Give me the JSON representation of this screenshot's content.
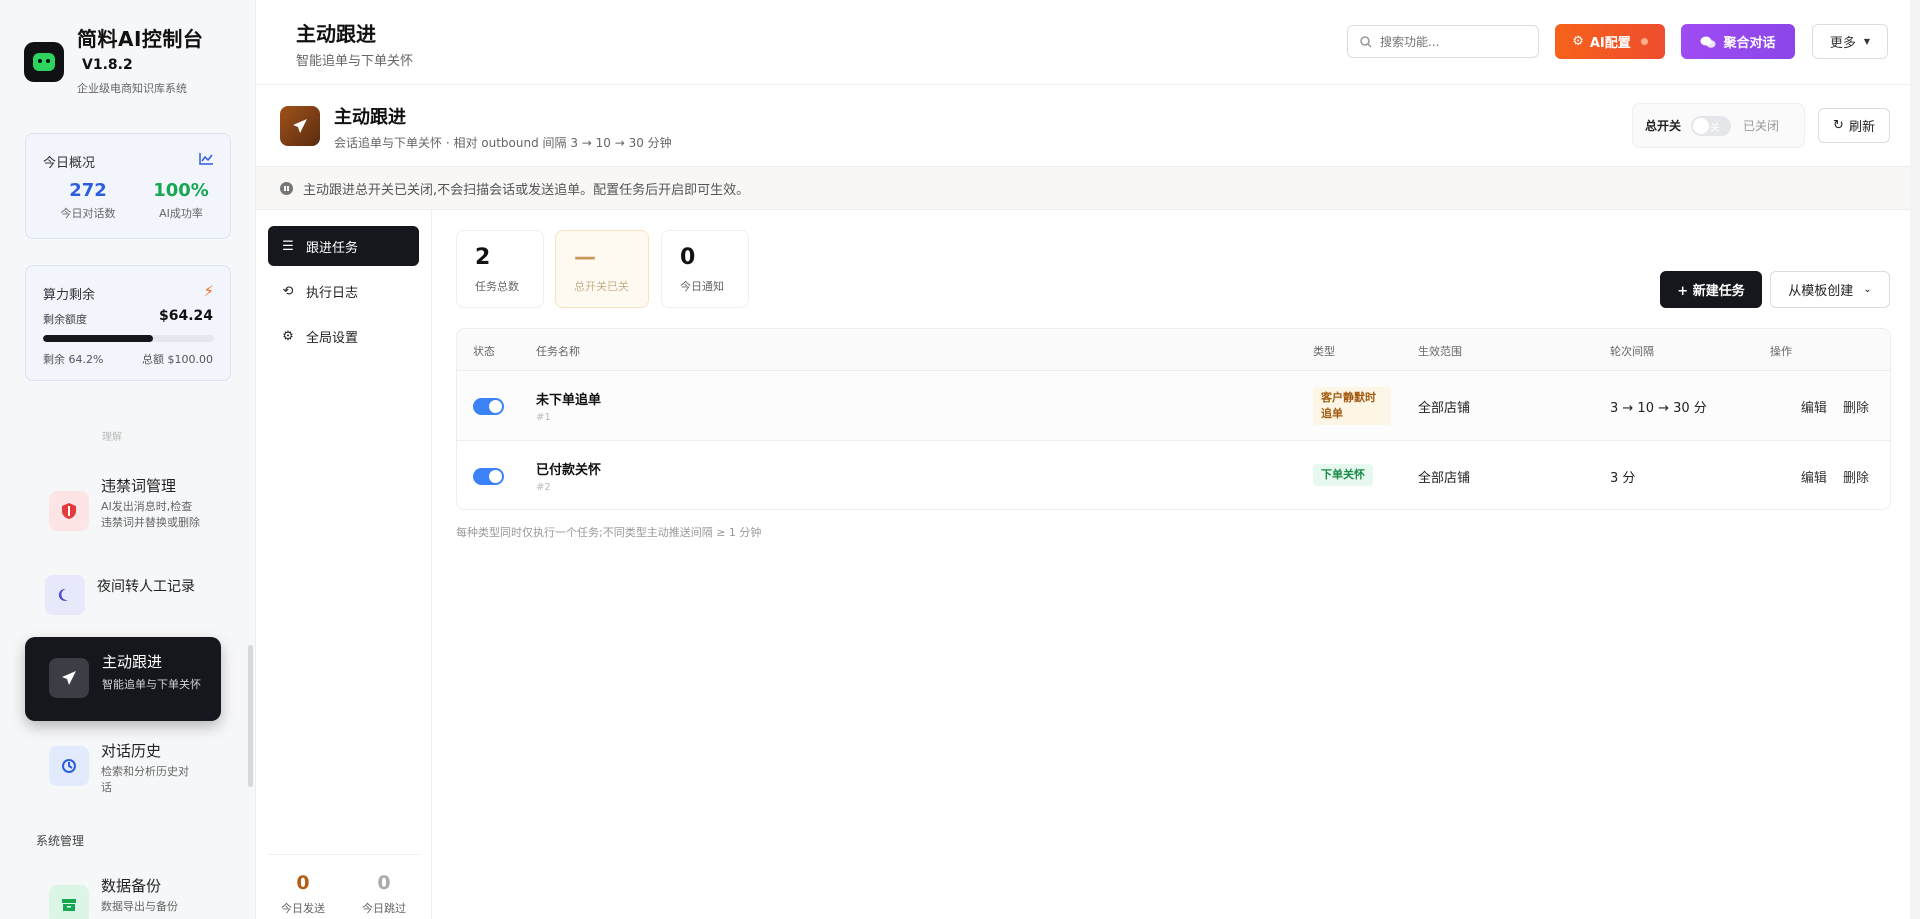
{
  "brand": {
    "name": "简料AI控制台",
    "version": "V1.8.2",
    "subtitle": "企业级电商知识库系统"
  },
  "today": {
    "title": "今日概况",
    "conversations": {
      "value": "272",
      "label": "今日对话数"
    },
    "ai_rate": {
      "value": "100%",
      "label": "AI成功率"
    }
  },
  "power": {
    "title": "算力剩余",
    "quota_label": "剩余额度",
    "quota_value": "$64.24",
    "left_label": "剩余 64.2%",
    "total_label": "总额 $100.00",
    "fill_percent": 64.2
  },
  "sidebar": {
    "faded_label": "理解",
    "ban": {
      "title": "违禁词管理",
      "desc": "AI发出消息时,检查违禁词并替换或删除"
    },
    "night": {
      "title": "夜间转人工记录",
      "desc": ""
    },
    "active": {
      "title": "主动跟进",
      "desc": "智能追单与下单关怀"
    },
    "history": {
      "title": "对话历史",
      "desc": "检索和分析历史对话"
    },
    "section_label": "系统管理",
    "backup": {
      "title": "数据备份",
      "desc": "数据导出与备份"
    }
  },
  "header": {
    "title": "主动跟进",
    "subtitle": "智能追单与下单关怀",
    "search_placeholder": "搜索功能...",
    "ai_config": "AI配置",
    "chat": "聚合对话",
    "more": "更多"
  },
  "page": {
    "title": "主动跟进",
    "subtitle": "会话追单与下单关怀 · 相对 outbound 间隔 3 → 10 → 30 分钟",
    "master_switch_label": "总开关",
    "master_switch_toggle": "关",
    "master_switch_state": "已关闭",
    "refresh": "刷新",
    "notice": "主动跟进总开关已关闭,不会扫描会话或发送追单。配置任务后开启即可生效。"
  },
  "subnav": {
    "items": [
      {
        "label": "跟进任务"
      },
      {
        "label": "执行日志"
      },
      {
        "label": "全局设置"
      }
    ],
    "today_sent": {
      "value": "0",
      "label": "今日发送"
    },
    "today_skip": {
      "value": "0",
      "label": "今日跳过"
    }
  },
  "kpis": [
    {
      "value": "2",
      "label": "任务总数"
    },
    {
      "value": "—",
      "label": "总开关已关"
    },
    {
      "value": "0",
      "label": "今日通知"
    }
  ],
  "actions": {
    "new_task": "+ 新建任务",
    "from_template": "从模板创建"
  },
  "table": {
    "columns": [
      "状态",
      "任务名称",
      "类型",
      "生效范围",
      "轮次间隔",
      "操作"
    ],
    "rows": [
      {
        "enabled": true,
        "name": "未下单追单",
        "id": "#1",
        "type": "客户静默时追单",
        "scope": "全部店铺",
        "interval": "3 → 10 → 30 分",
        "edit": "编辑",
        "delete": "删除"
      },
      {
        "enabled": true,
        "name": "已付款关怀",
        "id": "#2",
        "type": "下单关怀",
        "scope": "全部店铺",
        "interval": "3 分",
        "edit": "编辑",
        "delete": "删除"
      }
    ],
    "footnote": "每种类型同时仅执行一个任务;不同类型主动推送间隔 ≥ 1 分钟"
  }
}
